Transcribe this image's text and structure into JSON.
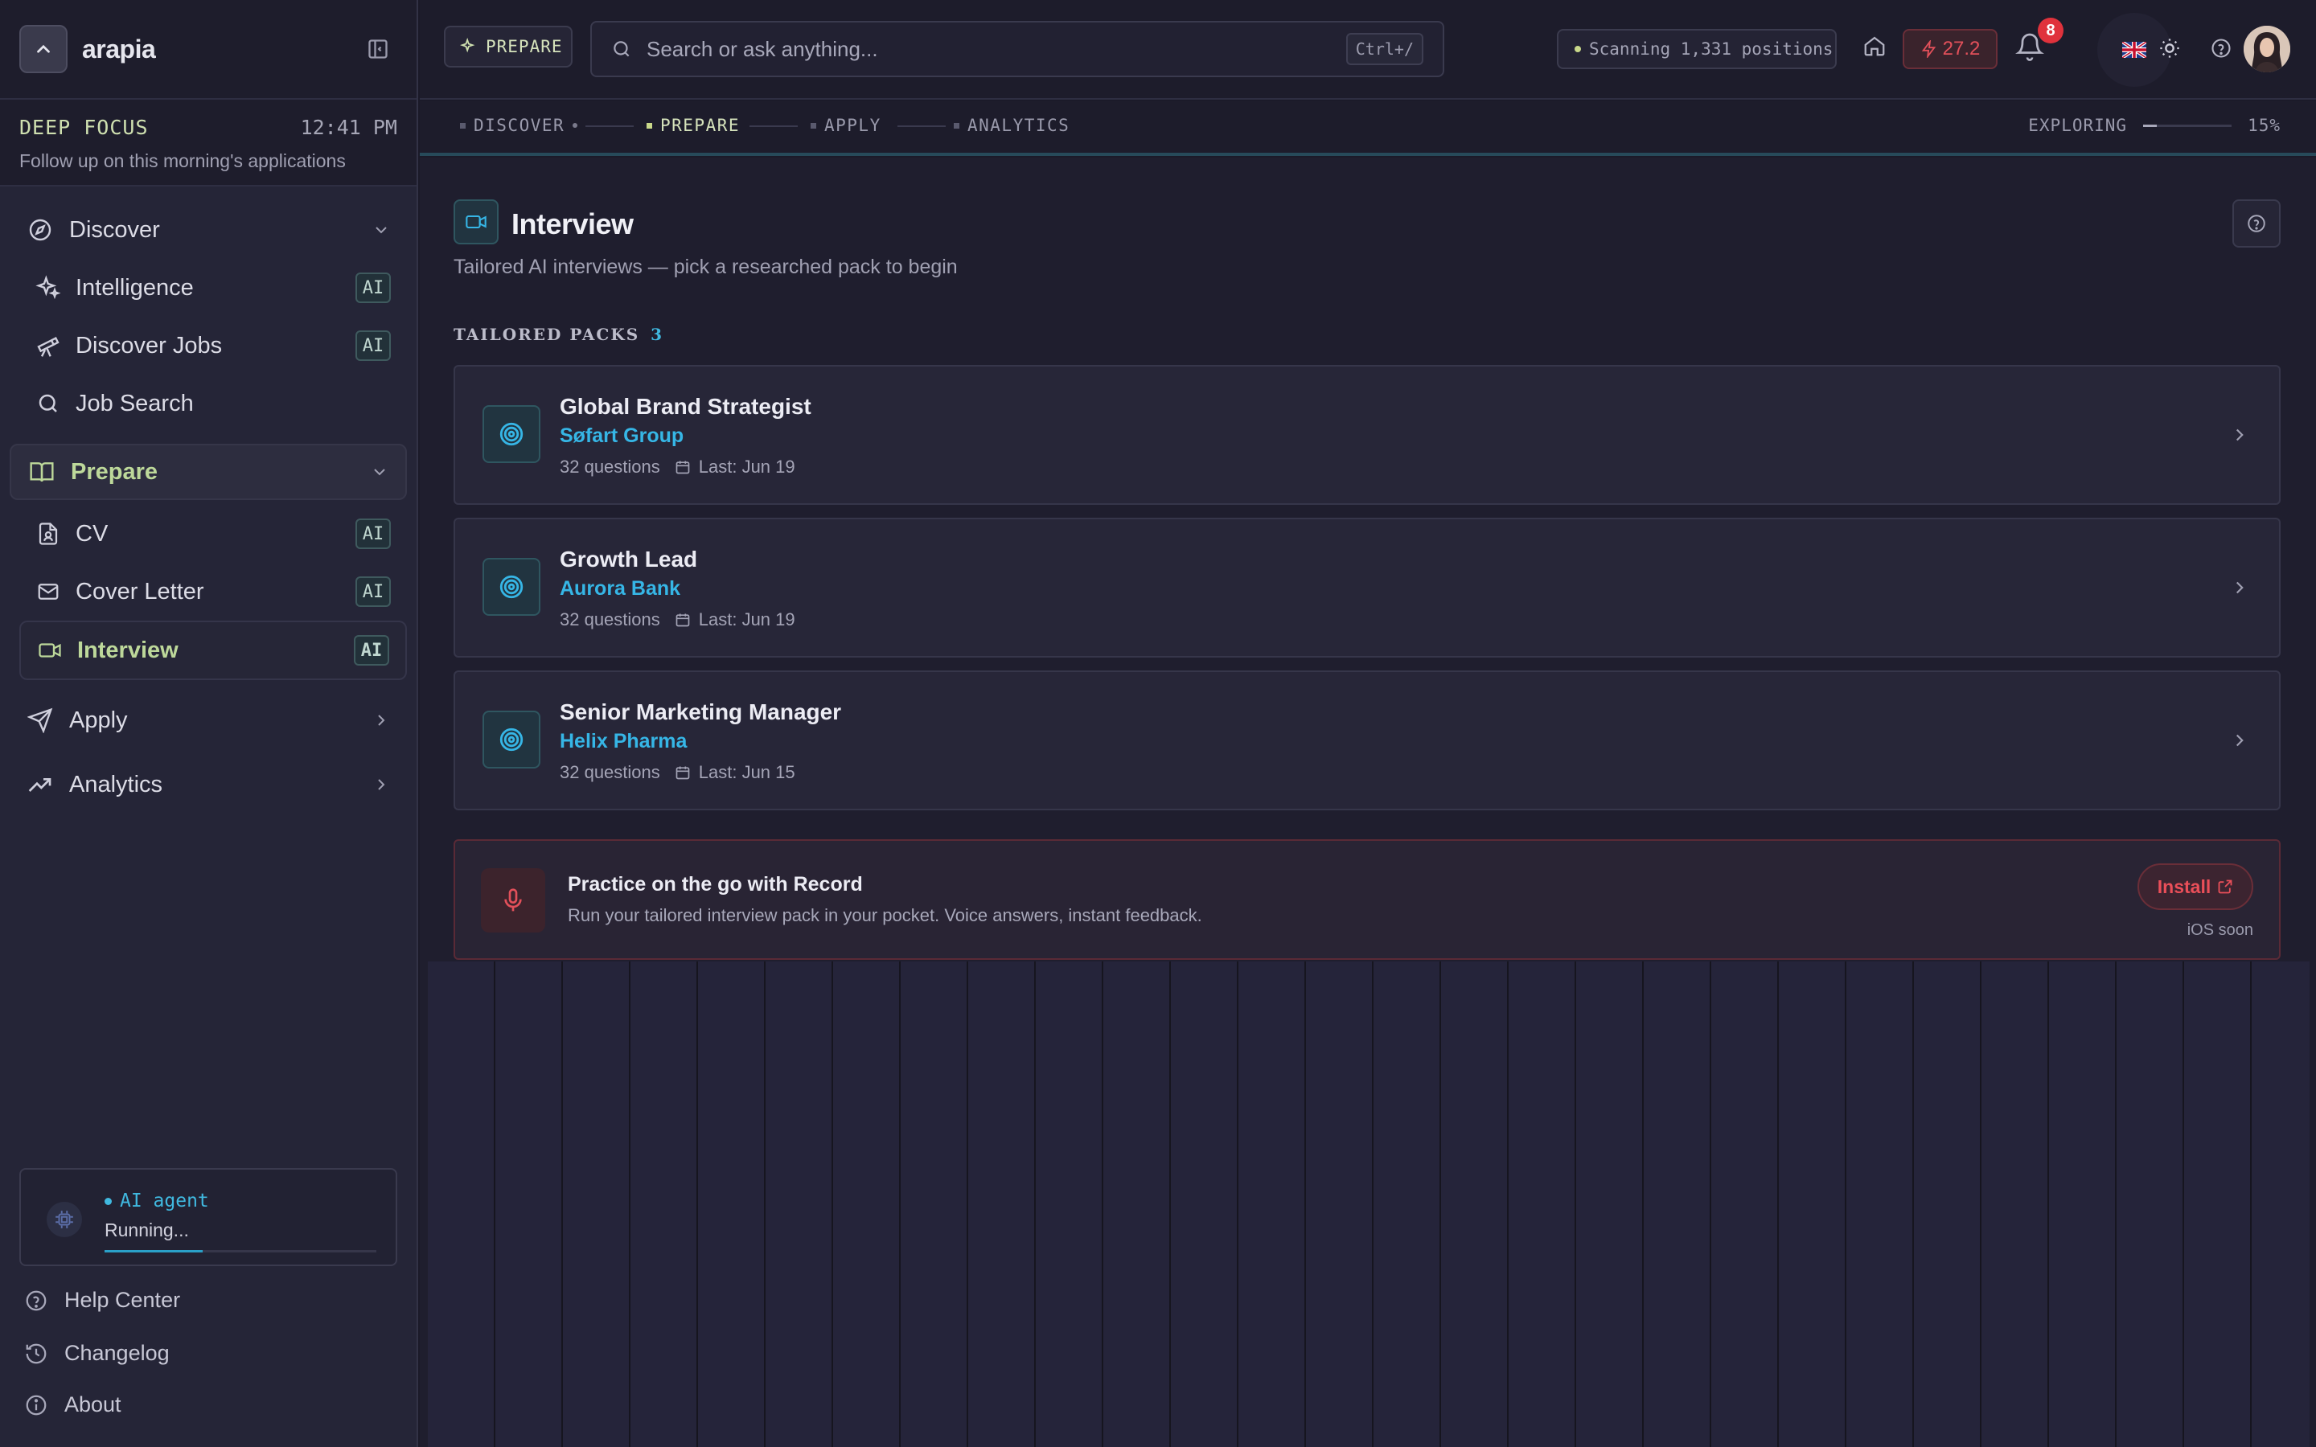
{
  "app": {
    "name": "arapia"
  },
  "focus": {
    "title": "DEEP FOCUS",
    "time": "12:41 PM",
    "subtitle": "Follow up on this morning's applications"
  },
  "sidebar": {
    "groups": [
      {
        "label": "Discover",
        "items": [
          {
            "label": "Intelligence",
            "badge": "AI"
          },
          {
            "label": "Discover Jobs",
            "badge": "AI"
          },
          {
            "label": "Job Search"
          }
        ]
      },
      {
        "label": "Prepare",
        "items": [
          {
            "label": "CV",
            "badge": "AI"
          },
          {
            "label": "Cover Letter",
            "badge": "AI"
          },
          {
            "label": "Interview",
            "badge": "AI"
          }
        ]
      },
      {
        "label": "Apply"
      },
      {
        "label": "Analytics"
      }
    ],
    "agent": {
      "label": "AI agent",
      "status": "Running...",
      "progress": 0.36
    },
    "footer": [
      "Help Center",
      "Changelog",
      "About"
    ]
  },
  "topbar": {
    "mode": "PREPARE",
    "search_placeholder": "Search or ask anything...",
    "shortcut": "Ctrl+/",
    "scanning": "Scanning 1,331 positions",
    "streak": "27.2",
    "notifications": "8"
  },
  "stepper": {
    "steps": [
      "DISCOVER",
      "PREPARE",
      "APPLY",
      "ANALYTICS"
    ],
    "active": "PREPARE",
    "exploring_label": "EXPLORING",
    "exploring_value": "15%",
    "exploring_progress": 0.15
  },
  "page": {
    "title": "Interview",
    "subtitle": "Tailored AI interviews — pick a researched pack to begin",
    "section_label": "TAILORED PACKS",
    "section_count": "3"
  },
  "packs": [
    {
      "title": "Global Brand Strategist",
      "company": "Søfart Group",
      "questions": "32 questions",
      "last": "Last: Jun 19"
    },
    {
      "title": "Growth Lead",
      "company": "Aurora Bank",
      "questions": "32 questions",
      "last": "Last: Jun 19"
    },
    {
      "title": "Senior Marketing Manager",
      "company": "Helix Pharma",
      "questions": "32 questions",
      "last": "Last: Jun 15"
    }
  ],
  "promo": {
    "title": "Practice on the go with Record",
    "subtitle": "Run your tailored interview pack in your pocket. Voice answers, instant feedback.",
    "button": "Install",
    "note": "iOS soon"
  },
  "colors": {
    "accent": "#36b6e6",
    "active_nav": "#bdd89a",
    "danger": "#e0323c"
  }
}
